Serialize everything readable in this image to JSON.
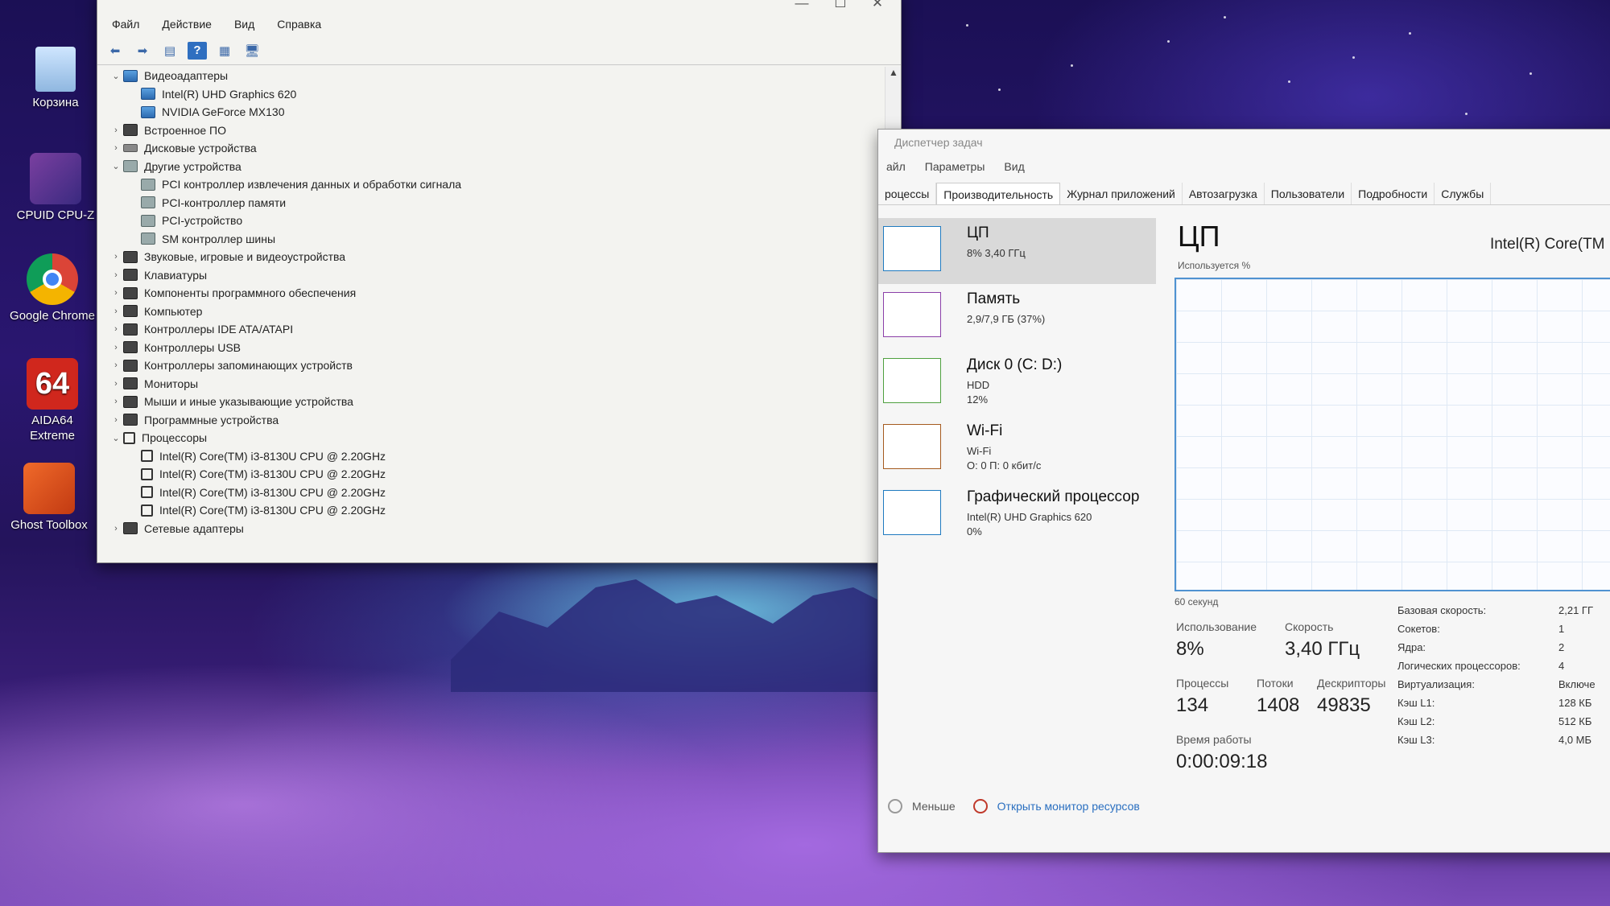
{
  "desktop": {
    "icons": [
      {
        "label": "Корзина",
        "icon": "recycle-bin-icon"
      },
      {
        "label": "CPUID CPU-Z",
        "icon": "cpuz-icon"
      },
      {
        "label": "Google Chrome",
        "icon": "chrome-icon"
      },
      {
        "label": "AIDA64 Extreme",
        "icon": "aida64-icon"
      },
      {
        "label": "Ghost Toolbox",
        "icon": "ghost-toolbox-icon"
      }
    ],
    "aida_badge": "64"
  },
  "device_manager": {
    "menu": [
      "Файл",
      "Действие",
      "Вид",
      "Справка"
    ],
    "tree": [
      {
        "label": "Видеоадаптеры",
        "level": 0,
        "expanded": true,
        "icon": "display-adapter-icon"
      },
      {
        "label": "Intel(R) UHD Graphics 620",
        "level": 1,
        "icon": "display-adapter-icon"
      },
      {
        "label": "NVIDIA GeForce MX130",
        "level": 1,
        "icon": "display-adapter-icon"
      },
      {
        "label": "Встроенное ПО",
        "level": 0,
        "expanded": false,
        "icon": "firmware-icon"
      },
      {
        "label": "Дисковые устройства",
        "level": 0,
        "expanded": false,
        "icon": "disk-drive-icon"
      },
      {
        "label": "Другие устройства",
        "level": 0,
        "expanded": true,
        "icon": "unknown-device-icon"
      },
      {
        "label": "PCI контроллер извлечения данных и обработки сигнала",
        "level": 1,
        "icon": "unknown-device-icon"
      },
      {
        "label": "PCI-контроллер памяти",
        "level": 1,
        "icon": "unknown-device-icon"
      },
      {
        "label": "PCI-устройство",
        "level": 1,
        "icon": "unknown-device-icon"
      },
      {
        "label": "SM контроллер шины",
        "level": 1,
        "icon": "unknown-device-icon"
      },
      {
        "label": "Звуковые, игровые и видеоустройства",
        "level": 0,
        "expanded": false,
        "icon": "sound-icon"
      },
      {
        "label": "Клавиатуры",
        "level": 0,
        "expanded": false,
        "icon": "keyboard-icon"
      },
      {
        "label": "Компоненты программного обеспечения",
        "level": 0,
        "expanded": false,
        "icon": "software-component-icon"
      },
      {
        "label": "Компьютер",
        "level": 0,
        "expanded": false,
        "icon": "computer-icon"
      },
      {
        "label": "Контроллеры IDE ATA/ATAPI",
        "level": 0,
        "expanded": false,
        "icon": "ide-controller-icon"
      },
      {
        "label": "Контроллеры USB",
        "level": 0,
        "expanded": false,
        "icon": "usb-icon"
      },
      {
        "label": "Контроллеры запоминающих устройств",
        "level": 0,
        "expanded": false,
        "icon": "storage-controller-icon"
      },
      {
        "label": "Мониторы",
        "level": 0,
        "expanded": false,
        "icon": "monitor-icon"
      },
      {
        "label": "Мыши и иные указывающие устройства",
        "level": 0,
        "expanded": false,
        "icon": "mouse-icon"
      },
      {
        "label": "Программные устройства",
        "level": 0,
        "expanded": false,
        "icon": "software-device-icon"
      },
      {
        "label": "Процессоры",
        "level": 0,
        "expanded": true,
        "icon": "processor-icon"
      },
      {
        "label": "Intel(R) Core(TM) i3-8130U CPU @ 2.20GHz",
        "level": 1,
        "icon": "processor-icon"
      },
      {
        "label": "Intel(R) Core(TM) i3-8130U CPU @ 2.20GHz",
        "level": 1,
        "icon": "processor-icon"
      },
      {
        "label": "Intel(R) Core(TM) i3-8130U CPU @ 2.20GHz",
        "level": 1,
        "icon": "processor-icon"
      },
      {
        "label": "Intel(R) Core(TM) i3-8130U CPU @ 2.20GHz",
        "level": 1,
        "icon": "processor-icon"
      },
      {
        "label": "Сетевые адаптеры",
        "level": 0,
        "expanded": false,
        "icon": "network-adapter-icon"
      }
    ]
  },
  "task_manager": {
    "title": "Диспетчер задач",
    "menu": [
      "айл",
      "Параметры",
      "Вид"
    ],
    "tabs": [
      "роцессы",
      "Производительность",
      "Журнал приложений",
      "Автозагрузка",
      "Пользователи",
      "Подробности",
      "Службы"
    ],
    "active_tab": "Производительность",
    "resources": [
      {
        "name": "ЦП",
        "line1": "8% 3,40 ГГц",
        "line2": "",
        "color": "#1f7ac0"
      },
      {
        "name": "Память",
        "line1": "2,9/7,9 ГБ (37%)",
        "line2": "",
        "color": "#8b3fa8"
      },
      {
        "name": "Диск 0 (C: D:)",
        "line1": "HDD",
        "line2": "12%",
        "color": "#4fa03f"
      },
      {
        "name": "Wi-Fi",
        "line1": "Wi-Fi",
        "line2": "О: 0 П: 0 кбит/с",
        "color": "#a55a1e"
      },
      {
        "name": "Графический процессор",
        "line1": "Intel(R) UHD Graphics 620",
        "line2": "0%",
        "color": "#1f7ac0"
      }
    ],
    "cpu": {
      "title": "ЦП",
      "model": "Intel(R) Core(TM",
      "graph_label": "Используется %",
      "graph_axis": "60 секунд",
      "usage_label": "Использование",
      "usage_value": "8%",
      "speed_label": "Скорость",
      "speed_value": "3,40 ГГц",
      "processes_label": "Процессы",
      "processes_value": "134",
      "threads_label": "Потоки",
      "threads_value": "1408",
      "handles_label": "Дескрипторы",
      "handles_value": "49835",
      "uptime_label": "Время работы",
      "uptime_value": "0:00:09:18",
      "specs": [
        {
          "k": "Базовая скорость:",
          "v": "2,21 ГГ"
        },
        {
          "k": "Сокетов:",
          "v": "1"
        },
        {
          "k": "Ядра:",
          "v": "2"
        },
        {
          "k": "Логических процессоров:",
          "v": "4"
        },
        {
          "k": "Виртуализация:",
          "v": "Включе"
        },
        {
          "k": "Кэш L1:",
          "v": "128 КБ"
        },
        {
          "k": "Кэш L2:",
          "v": "512 КБ"
        },
        {
          "k": "Кэш L3:",
          "v": "4,0 МБ"
        }
      ]
    },
    "footer": {
      "less_label": "Меньше",
      "monitor_label": "Открыть монитор ресурсов"
    }
  }
}
